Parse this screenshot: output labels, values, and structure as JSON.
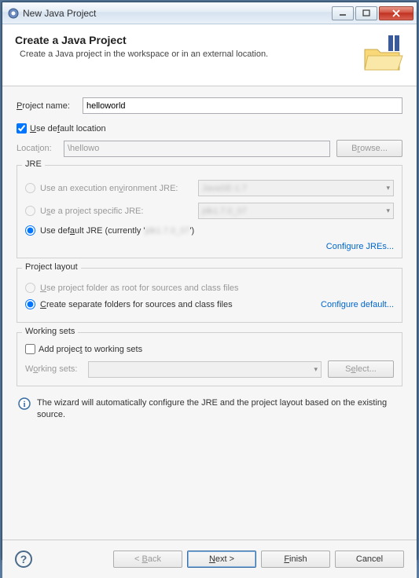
{
  "titlebar": {
    "title": "New Java Project"
  },
  "header": {
    "title": "Create a Java Project",
    "description": "Create a Java project in the workspace or in an external location."
  },
  "project_name": {
    "label": "Project name:",
    "value": "helloworld"
  },
  "default_location": {
    "checked": true,
    "label": "Use default location"
  },
  "location": {
    "label": "Location:",
    "value": "\\hellowo",
    "browse": "Browse..."
  },
  "jre": {
    "title": "JRE",
    "execution_env": {
      "label": "Use an execution environment JRE:",
      "value": "JavaSE-1.7"
    },
    "project_specific": {
      "label": "Use a project specific JRE:",
      "value": "jdk1.7.0_07"
    },
    "default": {
      "label_prefix": "Use default JRE (currently '",
      "label_suffix": "')",
      "value": "jdk1.7.0_07"
    },
    "configure_link": "Configure JREs..."
  },
  "layout": {
    "title": "Project layout",
    "root_folder": "Use project folder as root for sources and class files",
    "separate_folders": "Create separate folders for sources and class files",
    "configure_link": "Configure default..."
  },
  "working_sets": {
    "title": "Working sets",
    "add_checkbox": "Add project to working sets",
    "label": "Working sets:",
    "value": "",
    "select": "Select..."
  },
  "info": "The wizard will automatically configure the JRE and the project layout based on the existing source.",
  "footer": {
    "back": "< Back",
    "next": "Next >",
    "finish": "Finish",
    "cancel": "Cancel"
  }
}
